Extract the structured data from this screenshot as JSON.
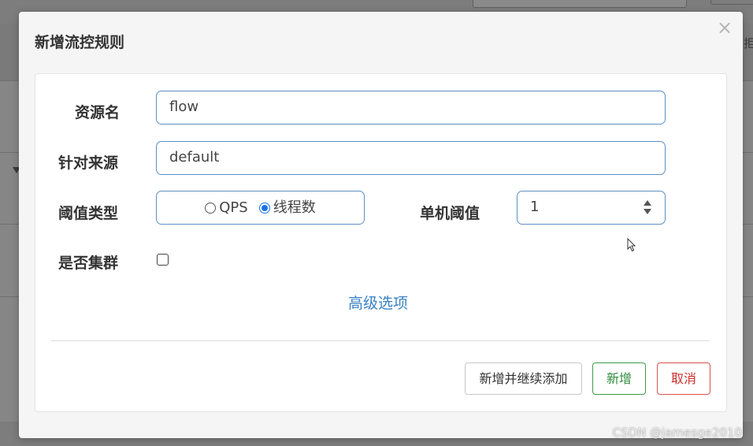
{
  "modal": {
    "title": "新增流控规则",
    "close_label": "×"
  },
  "form": {
    "resource_name": {
      "label": "资源名",
      "value": "flow"
    },
    "limit_app": {
      "label": "针对来源",
      "value": "default"
    },
    "threshold_type": {
      "label": "阈值类型",
      "options": [
        {
          "label": "QPS",
          "selected": false
        },
        {
          "label": "线程数",
          "selected": true
        }
      ]
    },
    "single_threshold": {
      "label": "单机阈值",
      "value": "1"
    },
    "cluster": {
      "label": "是否集群",
      "checked": false
    },
    "advanced_link": "高级选项"
  },
  "actions": {
    "add_continue": "新增并继续添加",
    "add": "新增",
    "cancel": "取消"
  },
  "watermark": "CSDN @jamesge2010",
  "background": {
    "edge_text": "拒"
  },
  "colors": {
    "input_border": "#5d8fc3",
    "link": "#3b82c4",
    "success": "#2f8a3d",
    "danger": "#c9302c",
    "radio_selected": "#1a73e8"
  }
}
